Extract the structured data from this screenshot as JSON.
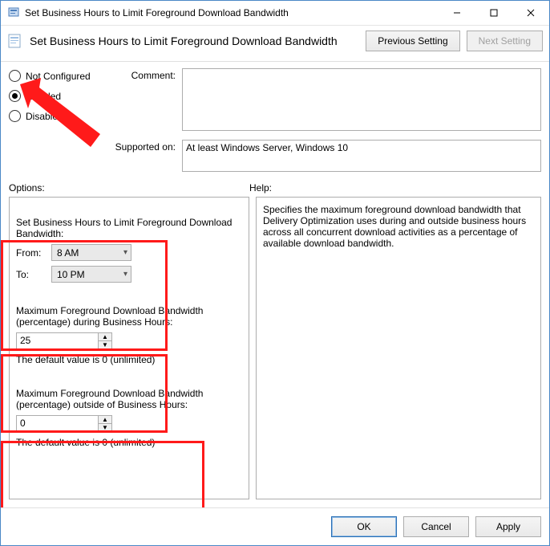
{
  "window": {
    "title": "Set Business Hours to Limit Foreground Download Bandwidth"
  },
  "header": {
    "policy_title": "Set Business Hours to Limit Foreground Download Bandwidth",
    "prev_label": "Previous Setting",
    "next_label": "Next Setting"
  },
  "state": {
    "not_configured_label": "Not Configured",
    "enabled_label": "Enabled",
    "disabled_label": "Disabled",
    "selected": "Enabled"
  },
  "labels": {
    "comment": "Comment:",
    "supported_on": "Supported on:",
    "options": "Options:",
    "help": "Help:"
  },
  "fields": {
    "comment_value": "",
    "supported_value": "At least Windows Server, Windows 10"
  },
  "options": {
    "section1_title": "Set Business Hours to Limit Foreground Download Bandwidth:",
    "from_label": "From:",
    "from_value": "8 AM",
    "to_label": "To:",
    "to_value": "10 PM",
    "section2_title": "Maximum Foreground Download Bandwidth (percentage) during Business Hours:",
    "section2_value": "25",
    "section2_hint": "The default value is 0 (unlimited)",
    "section3_title": "Maximum Foreground Download Bandwidth (percentage) outside of Business Hours:",
    "section3_value": "0",
    "section3_hint": "The default value is 0 (unlimited)"
  },
  "help": {
    "text": "Specifies the maximum foreground download bandwidth that Delivery Optimization uses during and outside business hours across all concurrent download activities as a percentage of available download bandwidth."
  },
  "footer": {
    "ok": "OK",
    "cancel": "Cancel",
    "apply": "Apply"
  }
}
